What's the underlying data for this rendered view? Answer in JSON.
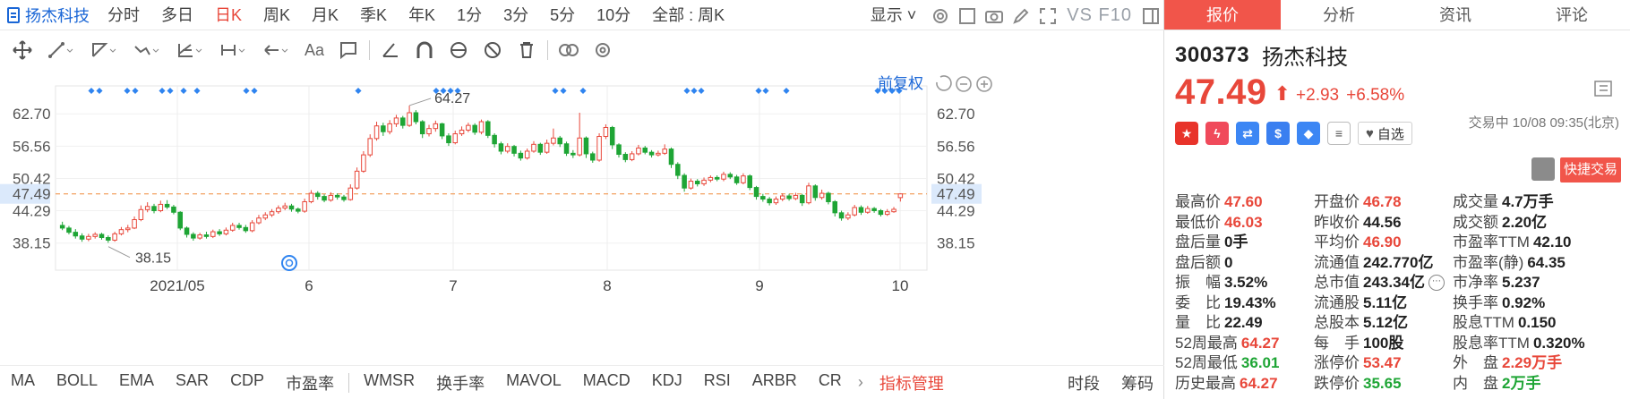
{
  "toolbar": {
    "stock_name": "扬杰科技",
    "periods": [
      "分时",
      "多日",
      "日K",
      "周K",
      "月K",
      "季K",
      "年K",
      "1分",
      "3分",
      "5分",
      "10分",
      "全部 : 周K"
    ],
    "active_period": "日K",
    "display_label": "显示",
    "vsf10_label": "VS F10"
  },
  "chart": {
    "restore_label": "前复权",
    "y_ticks": [
      "62.70",
      "56.56",
      "50.42",
      "47.49",
      "44.29",
      "38.15"
    ],
    "x_ticks": [
      "2021/05",
      "6",
      "7",
      "8",
      "9",
      "10"
    ],
    "current_price_line": "47.49",
    "annotation_high": "64.27",
    "annotation_low": "38.15"
  },
  "chart_data": {
    "type": "candlestick",
    "title": "",
    "ylim": [
      33,
      68
    ],
    "y_ticks": [
      62.7,
      56.56,
      50.42,
      44.29,
      38.15
    ],
    "reference_line": 47.49,
    "annotations": [
      {
        "label": "64.27",
        "type": "high"
      },
      {
        "label": "38.15",
        "type": "low"
      }
    ],
    "candles": [
      [
        41.5,
        41.0,
        42.2,
        40.6
      ],
      [
        41.0,
        40.2,
        41.4,
        39.8
      ],
      [
        40.2,
        39.5,
        40.8,
        39.0
      ],
      [
        39.5,
        38.9,
        40.0,
        38.4
      ],
      [
        38.9,
        39.4,
        39.9,
        38.5
      ],
      [
        39.4,
        39.8,
        40.2,
        39.0
      ],
      [
        39.8,
        39.2,
        40.1,
        38.8
      ],
      [
        39.2,
        38.7,
        39.6,
        38.2
      ],
      [
        38.7,
        39.9,
        40.3,
        38.4
      ],
      [
        39.9,
        40.7,
        41.2,
        39.6
      ],
      [
        40.7,
        41.0,
        41.6,
        40.2
      ],
      [
        41.0,
        42.6,
        43.2,
        40.8
      ],
      [
        42.6,
        44.5,
        45.3,
        42.3
      ],
      [
        44.5,
        45.1,
        45.9,
        44.0
      ],
      [
        45.1,
        44.3,
        45.6,
        43.8
      ],
      [
        44.3,
        45.5,
        46.2,
        44.0
      ],
      [
        45.5,
        45.0,
        46.3,
        44.6
      ],
      [
        45.0,
        44.0,
        45.4,
        43.6
      ],
      [
        44.0,
        41.0,
        44.2,
        40.6
      ],
      [
        41.0,
        39.8,
        41.3,
        39.2
      ],
      [
        39.8,
        39.1,
        40.2,
        38.6
      ],
      [
        39.1,
        39.7,
        40.1,
        38.8
      ],
      [
        39.7,
        39.4,
        40.3,
        39.0
      ],
      [
        39.4,
        40.3,
        40.7,
        39.1
      ],
      [
        40.3,
        39.9,
        40.8,
        39.5
      ],
      [
        39.9,
        40.6,
        41.1,
        39.6
      ],
      [
        40.6,
        41.5,
        42.0,
        40.3
      ],
      [
        41.5,
        41.1,
        42.0,
        40.7
      ],
      [
        41.1,
        40.5,
        41.6,
        40.1
      ],
      [
        40.5,
        42.0,
        42.5,
        40.2
      ],
      [
        42.0,
        42.9,
        43.5,
        41.7
      ],
      [
        42.9,
        43.5,
        44.0,
        42.5
      ],
      [
        43.5,
        44.1,
        44.6,
        43.1
      ],
      [
        44.1,
        44.8,
        45.3,
        43.7
      ],
      [
        44.8,
        45.2,
        45.8,
        44.4
      ],
      [
        45.2,
        44.6,
        45.6,
        44.1
      ],
      [
        44.6,
        44.2,
        44.9,
        43.8
      ],
      [
        44.2,
        46.0,
        46.6,
        43.9
      ],
      [
        46.0,
        47.6,
        48.2,
        45.7
      ],
      [
        47.6,
        47.0,
        48.0,
        46.4
      ],
      [
        47.0,
        46.3,
        47.4,
        45.9
      ],
      [
        46.3,
        47.2,
        47.8,
        46.0
      ],
      [
        47.2,
        46.9,
        47.6,
        46.4
      ],
      [
        46.9,
        46.4,
        47.3,
        46.0
      ],
      [
        46.4,
        48.6,
        49.3,
        46.2
      ],
      [
        48.6,
        51.8,
        52.5,
        48.3
      ],
      [
        51.8,
        54.9,
        55.6,
        51.5
      ],
      [
        54.9,
        58.0,
        58.8,
        54.5
      ],
      [
        58.0,
        60.4,
        61.2,
        57.6
      ],
      [
        60.4,
        59.3,
        61.0,
        58.5
      ],
      [
        59.3,
        60.8,
        61.5,
        58.8
      ],
      [
        60.8,
        61.9,
        62.5,
        60.2
      ],
      [
        61.9,
        60.5,
        62.3,
        59.9
      ],
      [
        60.5,
        62.9,
        64.27,
        60.2
      ],
      [
        62.9,
        61.2,
        63.4,
        60.7
      ],
      [
        61.2,
        58.9,
        61.5,
        58.1
      ],
      [
        58.9,
        59.9,
        60.6,
        58.4
      ],
      [
        59.9,
        60.8,
        61.4,
        59.3
      ],
      [
        60.8,
        58.5,
        61.0,
        57.9
      ],
      [
        58.5,
        57.2,
        59.0,
        56.6
      ],
      [
        57.2,
        58.9,
        59.5,
        56.9
      ],
      [
        58.9,
        59.6,
        60.3,
        58.5
      ],
      [
        59.6,
        60.5,
        61.0,
        59.2
      ],
      [
        60.5,
        59.2,
        60.9,
        58.7
      ],
      [
        59.2,
        61.2,
        61.6,
        58.8
      ],
      [
        61.2,
        58.6,
        61.5,
        58.1
      ],
      [
        58.6,
        57.0,
        59.0,
        56.3
      ],
      [
        57.0,
        55.6,
        57.4,
        55.0
      ],
      [
        55.6,
        56.5,
        57.1,
        55.2
      ],
      [
        56.5,
        55.2,
        56.8,
        54.6
      ],
      [
        55.2,
        54.3,
        55.7,
        53.8
      ],
      [
        54.3,
        55.6,
        56.1,
        54.0
      ],
      [
        55.6,
        56.9,
        57.5,
        55.3
      ],
      [
        56.9,
        55.4,
        57.2,
        54.9
      ],
      [
        55.4,
        57.1,
        57.8,
        55.1
      ],
      [
        57.1,
        58.1,
        59.9,
        56.7
      ],
      [
        58.1,
        57.0,
        58.5,
        56.4
      ],
      [
        57.0,
        55.2,
        57.4,
        54.7
      ],
      [
        55.2,
        54.9,
        55.8,
        54.3
      ],
      [
        54.9,
        58.1,
        62.9,
        54.6
      ],
      [
        58.1,
        55.1,
        58.4,
        54.3
      ],
      [
        55.1,
        53.9,
        55.5,
        53.4
      ],
      [
        53.9,
        58.4,
        59.0,
        53.6
      ],
      [
        58.4,
        60.1,
        60.7,
        57.9
      ],
      [
        60.1,
        56.8,
        60.4,
        56.0
      ],
      [
        56.8,
        55.0,
        57.1,
        54.4
      ],
      [
        55.0,
        54.0,
        55.4,
        53.5
      ],
      [
        54.0,
        55.1,
        55.6,
        53.7
      ],
      [
        55.1,
        56.2,
        56.8,
        54.8
      ],
      [
        56.2,
        55.4,
        56.6,
        55.0
      ],
      [
        55.4,
        54.9,
        55.8,
        54.4
      ],
      [
        54.9,
        55.2,
        55.7,
        54.6
      ],
      [
        55.2,
        56.0,
        56.9,
        54.9
      ],
      [
        56.0,
        53.1,
        56.3,
        52.4
      ],
      [
        53.1,
        51.0,
        53.5,
        50.3
      ],
      [
        51.0,
        48.6,
        51.4,
        47.9
      ],
      [
        48.6,
        49.9,
        50.4,
        48.3
      ],
      [
        49.9,
        49.4,
        50.3,
        48.9
      ],
      [
        49.4,
        50.1,
        50.6,
        49.0
      ],
      [
        50.1,
        50.6,
        51.0,
        49.7
      ],
      [
        50.6,
        50.3,
        51.0,
        49.9
      ],
      [
        50.3,
        51.2,
        51.7,
        49.9
      ],
      [
        51.2,
        50.7,
        51.6,
        50.3
      ],
      [
        50.7,
        49.6,
        51.1,
        49.2
      ],
      [
        49.6,
        50.9,
        51.4,
        49.3
      ],
      [
        50.9,
        48.7,
        51.2,
        48.2
      ],
      [
        48.7,
        47.0,
        49.0,
        46.4
      ],
      [
        47.0,
        46.5,
        47.5,
        46.0
      ],
      [
        46.5,
        45.8,
        46.9,
        45.3
      ],
      [
        45.8,
        46.5,
        47.0,
        45.4
      ],
      [
        46.5,
        47.1,
        47.6,
        46.1
      ],
      [
        47.1,
        46.6,
        47.5,
        46.2
      ],
      [
        46.6,
        47.2,
        47.7,
        46.3
      ],
      [
        47.2,
        45.8,
        47.5,
        45.2
      ],
      [
        45.8,
        49.0,
        49.6,
        45.5
      ],
      [
        49.0,
        46.8,
        49.3,
        46.2
      ],
      [
        46.8,
        47.6,
        48.3,
        46.4
      ],
      [
        47.6,
        46.0,
        47.9,
        45.5
      ],
      [
        46.0,
        43.9,
        46.3,
        43.2
      ],
      [
        43.9,
        42.9,
        44.3,
        42.4
      ],
      [
        42.9,
        43.5,
        44.0,
        42.5
      ],
      [
        43.5,
        44.9,
        45.4,
        43.2
      ],
      [
        44.9,
        44.0,
        45.3,
        43.5
      ],
      [
        44.0,
        44.7,
        45.2,
        43.7
      ],
      [
        44.7,
        44.3,
        45.0,
        43.9
      ],
      [
        44.3,
        43.6,
        44.6,
        43.2
      ],
      [
        43.6,
        44.1,
        44.6,
        43.3
      ],
      [
        44.1,
        44.56,
        45.0,
        43.9
      ],
      [
        46.78,
        47.49,
        47.6,
        46.03
      ]
    ],
    "signal_markers": [
      true
    ]
  },
  "indicators": {
    "items": [
      "MA",
      "BOLL",
      "EMA",
      "SAR",
      "CDP",
      "市盈率"
    ],
    "items2": [
      "WMSR",
      "换手率",
      "MAVOL",
      "MACD",
      "KDJ",
      "RSI",
      "ARBR",
      "CR"
    ],
    "manage_label": "指标管理",
    "right_items": [
      "时段",
      "筹码"
    ]
  },
  "quote": {
    "tabs": [
      "报价",
      "分析",
      "资讯",
      "评论"
    ],
    "active_tab": "报价",
    "code": "300373",
    "name": "扬杰科技",
    "price": "47.49",
    "change": "+2.93",
    "change_pct": "+6.58%",
    "status": "交易中 10/08 09:35(北京)",
    "watch_label": "自选",
    "fast_trade_label": "快捷交易",
    "rows": [
      [
        {
          "l": "最高价",
          "v": "47.60",
          "c": "red"
        },
        {
          "l": "开盘价",
          "v": "46.78",
          "c": "red"
        },
        {
          "l": "成交量",
          "v": "4.7万手",
          "c": "dark"
        }
      ],
      [
        {
          "l": "最低价",
          "v": "46.03",
          "c": "red"
        },
        {
          "l": "昨收价",
          "v": "44.56",
          "c": "dark"
        },
        {
          "l": "成交额",
          "v": "2.20亿",
          "c": "dark"
        }
      ],
      [
        {
          "l": "盘后量",
          "v": "0手",
          "c": "dark"
        },
        {
          "l": "平均价",
          "v": "46.90",
          "c": "red"
        },
        {
          "l": "市盈率TTM",
          "v": "42.10",
          "c": "dark"
        }
      ],
      [
        {
          "l": "盘后额",
          "v": "0",
          "c": "dark"
        },
        {
          "l": "流通值",
          "v": "242.770亿",
          "c": "dark"
        },
        {
          "l": "市盈率(静)",
          "v": "64.35",
          "c": "dark"
        }
      ],
      [
        {
          "l": "振　幅",
          "v": "3.52%",
          "c": "dark"
        },
        {
          "l": "总市值",
          "v": "243.34亿",
          "c": "dark"
        },
        {
          "l": "市净率",
          "v": "5.237",
          "c": "dark"
        }
      ],
      [
        {
          "l": "委　比",
          "v": "19.43%",
          "c": "dark"
        },
        {
          "l": "流通股",
          "v": "5.11亿",
          "c": "dark"
        },
        {
          "l": "换手率",
          "v": "0.92%",
          "c": "dark"
        }
      ],
      [
        {
          "l": "量　比",
          "v": "22.49",
          "c": "dark"
        },
        {
          "l": "总股本",
          "v": "5.12亿",
          "c": "dark"
        },
        {
          "l": "股息TTM",
          "v": "0.150",
          "c": "dark"
        }
      ],
      [
        {
          "l": "52周最高",
          "v": "64.27",
          "c": "red"
        },
        {
          "l": "每　手",
          "v": "100股",
          "c": "dark"
        },
        {
          "l": "股息率TTM",
          "v": "0.320%",
          "c": "dark"
        }
      ],
      [
        {
          "l": "52周最低",
          "v": "36.01",
          "c": "green"
        },
        {
          "l": "涨停价",
          "v": "53.47",
          "c": "red"
        },
        {
          "l": "外　盘",
          "v": "2.29万手",
          "c": "red"
        }
      ],
      [
        {
          "l": "历史最高",
          "v": "64.27",
          "c": "red"
        },
        {
          "l": "跌停价",
          "v": "35.65",
          "c": "green"
        },
        {
          "l": "内　盘",
          "v": "2万手",
          "c": "green"
        }
      ]
    ]
  },
  "colors": {
    "up": "#e8473a",
    "down": "#1ea535",
    "accent": "#1a66d6",
    "tab_active": "#f1554a"
  }
}
